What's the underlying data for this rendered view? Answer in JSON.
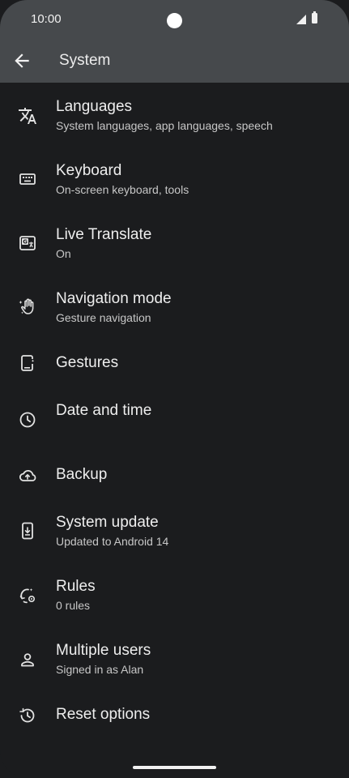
{
  "status_bar": {
    "time": "10:00"
  },
  "header": {
    "title": "System"
  },
  "items": [
    {
      "label": "Languages",
      "summary": "System languages, app languages, speech",
      "icon": "translate-icon"
    },
    {
      "label": "Keyboard",
      "summary": "On-screen keyboard, tools",
      "icon": "keyboard-icon"
    },
    {
      "label": "Live Translate",
      "summary": "On",
      "icon": "live-translate-icon"
    },
    {
      "label": "Navigation mode",
      "summary": "Gesture navigation",
      "icon": "gesture-hand-icon"
    },
    {
      "label": "Gestures",
      "summary": "",
      "icon": "gestures-phone-icon"
    },
    {
      "label": "Date and time",
      "summary": "",
      "icon": "clock-icon"
    },
    {
      "label": "Backup",
      "summary": "",
      "icon": "cloud-upload-icon"
    },
    {
      "label": "System update",
      "summary": "Updated to Android 14",
      "icon": "system-update-icon"
    },
    {
      "label": "Rules",
      "summary": "0 rules",
      "icon": "rules-icon"
    },
    {
      "label": "Multiple users",
      "summary": "Signed in as Alan",
      "icon": "person-icon"
    },
    {
      "label": "Reset options",
      "summary": "",
      "icon": "history-icon"
    }
  ]
}
